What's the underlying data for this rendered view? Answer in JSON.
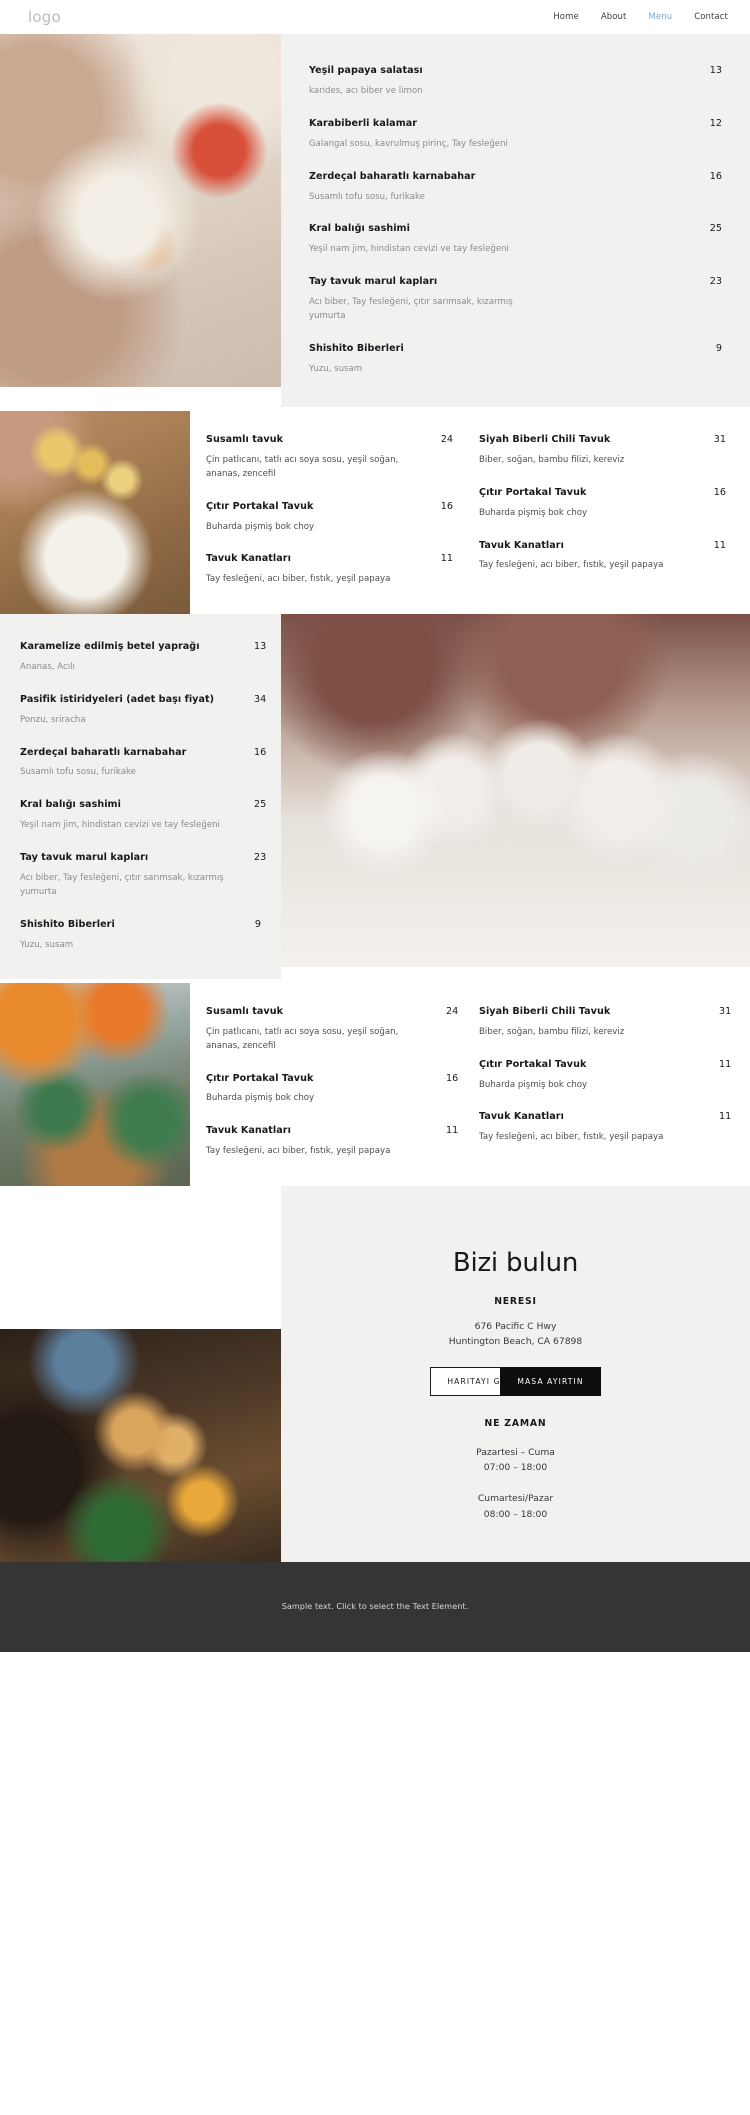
{
  "header": {
    "logo": "logo",
    "nav": [
      {
        "label": "Home",
        "active": false
      },
      {
        "label": "About",
        "active": false
      },
      {
        "label": "Menu",
        "active": true
      },
      {
        "label": "Contact",
        "active": false
      }
    ]
  },
  "section1": {
    "items": [
      {
        "name": "Yeşil papaya salatası",
        "price": "13",
        "desc": "karides, acı biber ve limon"
      },
      {
        "name": "Karabiberli kalamar",
        "price": "12",
        "desc": "Galangal sosu, kavrulmuş pirinç, Tay fesleğeni"
      },
      {
        "name": "Zerdeçal baharatlı karnabahar",
        "price": "16",
        "desc": "Susamlı tofu sosu, furikake"
      },
      {
        "name": "Kral balığı sashimi",
        "price": "25",
        "desc": "Yeşil nam jim, hindistan cevizi ve tay fesleğeni"
      },
      {
        "name": "Tay tavuk marul kapları",
        "price": "23",
        "desc": "Acı biber, Tay fesleğeni, çıtır sarımsak, kızarmış yumurta"
      },
      {
        "name": "Shishito Biberleri",
        "price": "9",
        "desc": "Yuzu, susam"
      }
    ]
  },
  "section2": {
    "left": [
      {
        "name": "Susamlı tavuk",
        "price": "24",
        "desc": "Çin patlıcanı, tatlı acı soya sosu, yeşil soğan, ananas, zencefil"
      },
      {
        "name": "Çıtır Portakal Tavuk",
        "price": "16",
        "desc": "Buharda pişmiş bok choy"
      },
      {
        "name": "Tavuk Kanatları",
        "price": "11",
        "desc": "Tay fesleğeni, acı biber, fıstık, yeşil papaya"
      }
    ],
    "right": [
      {
        "name": "Siyah Biberli Chili Tavuk",
        "price": "31",
        "desc": "Biber, soğan, bambu filizi, kereviz"
      },
      {
        "name": "Çıtır Portakal Tavuk",
        "price": "16",
        "desc": "Buharda pişmiş bok choy"
      },
      {
        "name": "Tavuk Kanatları",
        "price": "11",
        "desc": "Tay fesleğeni, acı biber, fıstık, yeşil papaya"
      }
    ]
  },
  "section3": {
    "items": [
      {
        "name": "Karamelize edilmiş betel yaprağı",
        "price": "13",
        "desc": "Ananas, Acılı"
      },
      {
        "name": "Pasifik istiridyeleri (adet başı fiyat)",
        "price": "34",
        "desc": "Ponzu, sriracha"
      },
      {
        "name": "Zerdeçal baharatlı karnabahar",
        "price": "16",
        "desc": "Susamlı tofu sosu, furikake"
      },
      {
        "name": "Kral balığı sashimi",
        "price": "25",
        "desc": "Yeşil nam jim, hindistan cevizi ve tay fesleğeni"
      },
      {
        "name": "Tay tavuk marul kapları",
        "price": "23",
        "desc": "Acı biber, Tay fesleğeni, çıtır sarımsak, kızarmış yumurta"
      },
      {
        "name": "Shishito Biberleri",
        "price": "9",
        "desc": "Yuzu, susam"
      }
    ]
  },
  "section4": {
    "left": [
      {
        "name": "Susamlı tavuk",
        "price": "24",
        "desc": "Çin patlıcanı, tatlı acı soya sosu, yeşil soğan, ananas, zencefil"
      },
      {
        "name": "Çıtır Portakal Tavuk",
        "price": "16",
        "desc": "Buharda pişmiş bok choy"
      },
      {
        "name": "Tavuk Kanatları",
        "price": "11",
        "desc": "Tay fesleğeni, acı biber, fıstık, yeşil papaya"
      }
    ],
    "right": [
      {
        "name": "Siyah Biberli Chili Tavuk",
        "price": "31",
        "desc": "Biber, soğan, bambu filizi, kereviz"
      },
      {
        "name": "Çıtır Portakal Tavuk",
        "price": "11",
        "desc": "Buharda pişmiş bok choy"
      },
      {
        "name": "Tavuk Kanatları",
        "price": "11",
        "desc": "Tay fesleğeni, acı biber, fıstık, yeşil papaya"
      }
    ]
  },
  "contact": {
    "title": "Bizi bulun",
    "where_label": "NERESI",
    "address_line1": "676 Pacific C Hwy",
    "address_line2": "Huntington Beach, CA 67898",
    "btn_map": "HARITAYI GÖR",
    "btn_reserve": "MASA AYIRTIN",
    "when_label": "NE ZAMAN",
    "hours": [
      {
        "days": "Pazartesi – Cuma",
        "time": "07:00 – 18:00"
      },
      {
        "days": "Cumartesi/Pazar",
        "time": "08:00 – 18:00"
      }
    ]
  },
  "footer": {
    "text": "Sample text. Click to select the Text Element."
  },
  "colors": {
    "accent": "#7fa9cc",
    "panel_gray": "#f1f1f0",
    "footer_bg": "#353535",
    "text": "#17191a",
    "muted": "#8b8b8b"
  }
}
